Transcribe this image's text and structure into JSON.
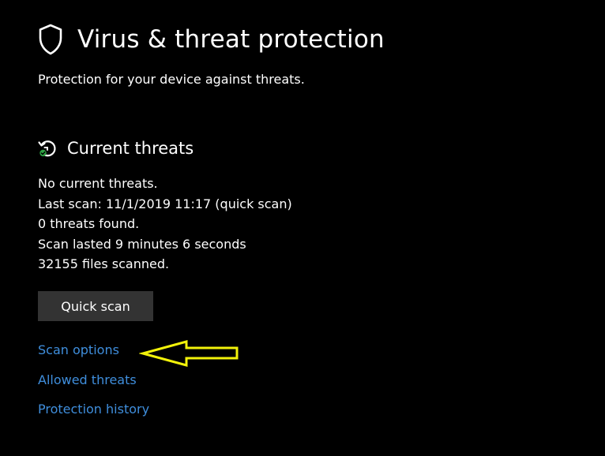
{
  "header": {
    "icon": "shield-icon",
    "title": "Virus & threat protection",
    "subtitle": "Protection for your device against threats."
  },
  "current_threats": {
    "icon": "refresh-check-icon",
    "title": "Current threats",
    "lines": [
      "No current threats.",
      "Last scan: 11/1/2019 11:17 (quick scan)",
      "0 threats found.",
      "Scan lasted 9 minutes 6 seconds",
      "32155 files scanned."
    ],
    "quick_scan_label": "Quick scan"
  },
  "links": {
    "scan_options": "Scan options",
    "allowed_threats": "Allowed threats",
    "protection_history": "Protection history"
  },
  "annotation": {
    "icon": "arrow-left-icon",
    "color": "#f2f20a"
  },
  "colors": {
    "background": "#000000",
    "text": "#ffffff",
    "link": "#3f8edc",
    "button": "#333333",
    "status_ok": "#2ea043"
  }
}
